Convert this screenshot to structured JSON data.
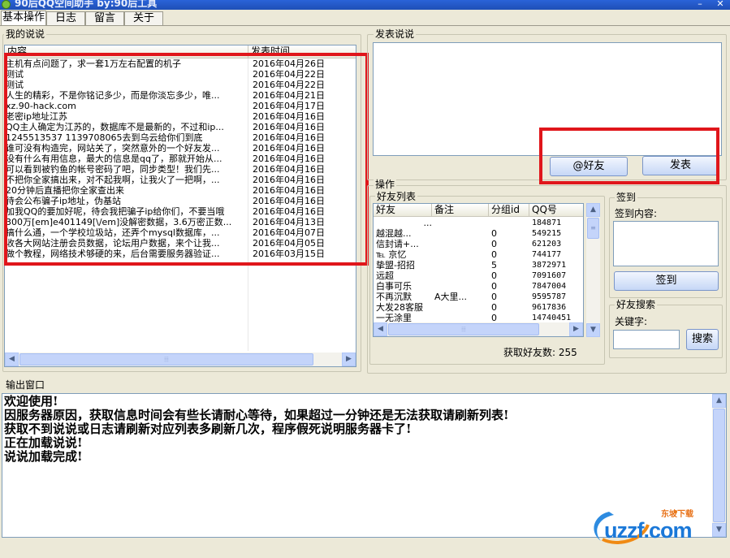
{
  "window": {
    "title": "90后QQ空间助手    by:90后工具",
    "minimize_glyph": "–",
    "close_glyph": "✕"
  },
  "tabs": [
    {
      "label": "基本操作",
      "active": true
    },
    {
      "label": "日志"
    },
    {
      "label": "留言"
    },
    {
      "label": "关于"
    }
  ],
  "my_posts": {
    "group_label": "我的说说",
    "columns": [
      "内容",
      "发表时间"
    ],
    "rows": [
      {
        "content": "主机有点问题了，求一套1万左右配置的机子",
        "date": "2016年04月26日"
      },
      {
        "content": "测试",
        "date": "2016年04月22日"
      },
      {
        "content": "测试",
        "date": "2016年04月22日"
      },
      {
        "content": "人生的精彩，不是你铭记多少，而是你淡忘多少，唯...",
        "date": "2016年04月21日"
      },
      {
        "content": "xz.90-hack.com",
        "date": "2016年04月17日"
      },
      {
        "content": "老密ip地址江苏",
        "date": "2016年04月16日"
      },
      {
        "content": "QQ主人确定为江苏的，数据库不是最新的，不过和ip...",
        "date": "2016年04月16日"
      },
      {
        "content": "1245513537 1139708065去到乌云给你们到底",
        "date": "2016年04月16日"
      },
      {
        "content": "谁可没有构造完，网站关了，突然意外的一个好友发...",
        "date": "2016年04月16日"
      },
      {
        "content": "没有什么有用信息，最大的信息是qq了，那就开始从...",
        "date": "2016年04月16日"
      },
      {
        "content": "可以看到被钓鱼的帐号密码了吧，同步类型！我们先...",
        "date": "2016年04月16日"
      },
      {
        "content": "不把你全家搞出来，对不起我啊，让我火了一把啊，...",
        "date": "2016年04月16日"
      },
      {
        "content": "20分钟后直播把你全家查出来",
        "date": "2016年04月16日"
      },
      {
        "content": "待会公布骗子ip地址，伪基站",
        "date": "2016年04月16日"
      },
      {
        "content": "加我QQ的要加好呢，待会我把骗子ip给你们，不要当哦",
        "date": "2016年04月16日"
      },
      {
        "content": "300万[em]e401149[\\/em]没解密数据，3.6万密正数...",
        "date": "2016年04月13日"
      },
      {
        "content": "搞什么通，一个学校垃圾站，还弄个mysql数据库，...",
        "date": "2016年04月07日"
      },
      {
        "content": "收各大网站注册会员数据，论坛用户数据，来个让我...",
        "date": "2016年04月05日"
      },
      {
        "content": "做个教程，网络技术够硬的来，后台需要服务器验证...",
        "date": "2016年03月15日"
      }
    ]
  },
  "publish": {
    "group_label": "发表说说",
    "at_friend_button": "@好友",
    "publish_button": "发表"
  },
  "actions": {
    "group_label": "操作",
    "friends": {
      "group_label": "好友列表",
      "columns": [
        "好友",
        "备注",
        "分组id",
        "QQ号"
      ],
      "rows": [
        {
          "name": "...",
          "note": "",
          "group": "",
          "qq": "184871"
        },
        {
          "name": "越混越...",
          "note": "",
          "group": "0",
          "qq": "549215"
        },
        {
          "name": "信封请+...",
          "note": "",
          "group": "0",
          "qq": "621203"
        },
        {
          "name": "℡ 京忆",
          "note": "",
          "group": "0",
          "qq": "744177"
        },
        {
          "name": "挚盟-招招",
          "note": "",
          "group": "5",
          "qq": "3872971"
        },
        {
          "name": "远超",
          "note": "",
          "group": "0",
          "qq": "7091607"
        },
        {
          "name": "白事可乐",
          "note": "",
          "group": "0",
          "qq": "7847004"
        },
        {
          "name": "不再沉默",
          "note": "A大里...",
          "group": "0",
          "qq": "9595787"
        },
        {
          "name": "大发28客服",
          "note": "",
          "group": "0",
          "qq": "9617836"
        },
        {
          "name": "一无涂里",
          "note": "",
          "group": "0",
          "qq": "14740451"
        }
      ],
      "count_text": "获取好友数: 255"
    },
    "signin": {
      "group_label": "签到",
      "content_label": "签到内容:",
      "button": "签到"
    },
    "search": {
      "group_label": "好友搜索",
      "keyword_label": "关键字:",
      "button": "搜索"
    }
  },
  "output": {
    "group_label": "输出窗口",
    "lines": [
      "欢迎使用!",
      "因服务器原因，获取信息时间会有些长请耐心等待，如果超过一分钟还是无法获取请刷新列表!",
      "获取不到说说或日志请刷新对应列表多刷新几次，程序假死说明服务器卡了!",
      "正在加载说说!",
      "说说加载完成!"
    ]
  },
  "watermark": {
    "text": "uzzf.com",
    "small_text": "东坡下载"
  },
  "colors": {
    "highlight_box": "#e0161b",
    "titlebar": "#2a63d8",
    "panel_bg": "#ece9d8"
  }
}
